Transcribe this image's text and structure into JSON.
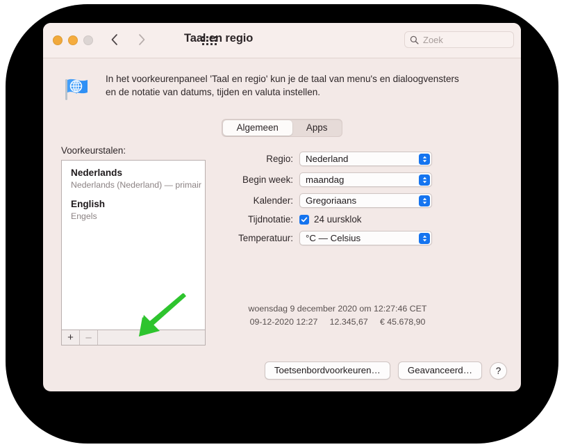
{
  "window": {
    "title": "Taal en regio",
    "traffic_lights": [
      "close-button",
      "minimize-button",
      "zoom-button"
    ],
    "back_label": "‹",
    "forward_label": "›",
    "grid_icon": "show-all-icon"
  },
  "search": {
    "placeholder": "Zoek",
    "value": "",
    "icon": "search-icon"
  },
  "description": {
    "icon": "flag-globe-icon",
    "text": "In het voorkeurenpaneel 'Taal en regio' kun je de taal van menu's en dialoogvensters en de notatie van datums, tijden en valuta instellen."
  },
  "tabs": [
    {
      "label": "Algemeen",
      "selected": true
    },
    {
      "label": "Apps",
      "selected": false
    }
  ],
  "languages": {
    "section_label": "Voorkeurstalen:",
    "items": [
      {
        "primary": "Nederlands",
        "secondary": "Nederlands (Nederland) — primair"
      },
      {
        "primary": "English",
        "secondary": "Engels"
      }
    ],
    "add_label": "+",
    "remove_label": "–"
  },
  "settings": {
    "region": {
      "label": "Regio:",
      "value": "Nederland"
    },
    "week_start": {
      "label": "Begin week:",
      "value": "maandag"
    },
    "calendar": {
      "label": "Kalender:",
      "value": "Gregoriaans"
    },
    "time_format": {
      "label": "Tijdnotatie:",
      "checkbox_label": "24 uursklok",
      "checked": true
    },
    "temperature": {
      "label": "Temperatuur:",
      "value": "°C — Celsius"
    }
  },
  "preview": {
    "line1": "woensdag 9 december 2020 om 12:27:46 CET",
    "line2": "09-12-2020 12:27     12.345,67     € 45.678,90"
  },
  "footer": {
    "keyboard_button": "Toetsenbordvoorkeuren…",
    "advanced_button": "Geavanceerd…",
    "help_button": "?"
  },
  "annotation": {
    "arrow_color": "#2ec42e",
    "points_at": "add-language-button"
  },
  "colors": {
    "accent": "#1574ef",
    "window_bg": "#f3e9e7",
    "titlebar_bg": "#f7eeec",
    "backdrop": "#000000"
  }
}
